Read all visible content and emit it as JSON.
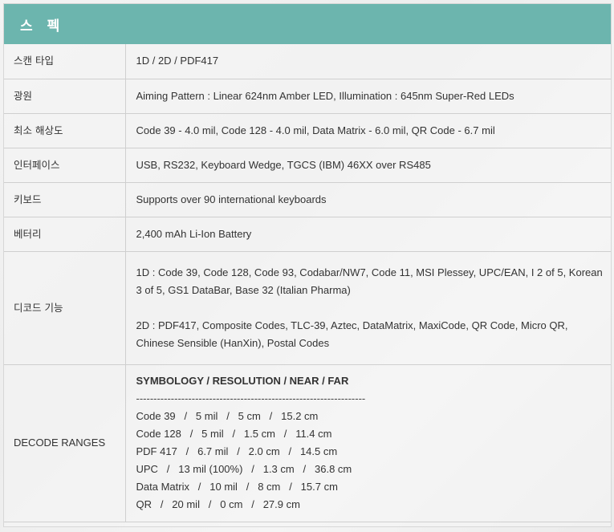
{
  "header": {
    "title": "스펙"
  },
  "rows": [
    {
      "label": "스캔 타입",
      "value": "1D / 2D / PDF417"
    },
    {
      "label": "광원",
      "value": "Aiming Pattern : Linear 624nm Amber LED, Illumination : 645nm Super-Red LEDs"
    },
    {
      "label": "최소 해상도",
      "value": "Code 39 - 4.0 mil, Code 128 - 4.0 mil, Data Matrix - 6.0 mil, QR Code - 6.7 mil"
    },
    {
      "label": "인터페이스",
      "value": "USB, RS232, Keyboard Wedge, TGCS (IBM) 46XX over RS485"
    },
    {
      "label": "키보드",
      "value": "Supports over 90 international keyboards"
    },
    {
      "label": "베터리",
      "value": "2,400 mAh Li-Ion Battery"
    }
  ],
  "decode": {
    "label": "디코드 기능",
    "line_1d": "1D : Code 39, Code 128, Code 93, Codabar/NW7, Code 11, MSI Plessey, UPC/EAN, I 2 of 5, Korean 3 of 5, GS1 DataBar, Base 32 (Italian Pharma)",
    "line_2d": "2D : PDF417, Composite Codes, TLC-39, Aztec, DataMatrix, MaxiCode, QR Code, Micro QR, Chinese Sensible (HanXin), Postal Codes"
  },
  "ranges": {
    "label": "DECODE RANGES",
    "title": "SYMBOLOGY / RESOLUTION / NEAR / FAR",
    "dashes": "------------------------------------------------------------------",
    "lines": [
      "Code 39   /   5 mil   /   5 cm   /   15.2 cm",
      "Code 128   /   5 mil   /   1.5 cm   /   11.4 cm",
      "PDF 417   /   6.7 mil   /   2.0 cm   /   14.5 cm",
      "UPC   /   13 mil (100%)   /   1.3 cm   /   36.8 cm",
      "Data Matrix   /   10 mil   /   8 cm   /   15.7 cm",
      "QR   /   20 mil   /   0 cm   /   27.9 cm"
    ]
  }
}
